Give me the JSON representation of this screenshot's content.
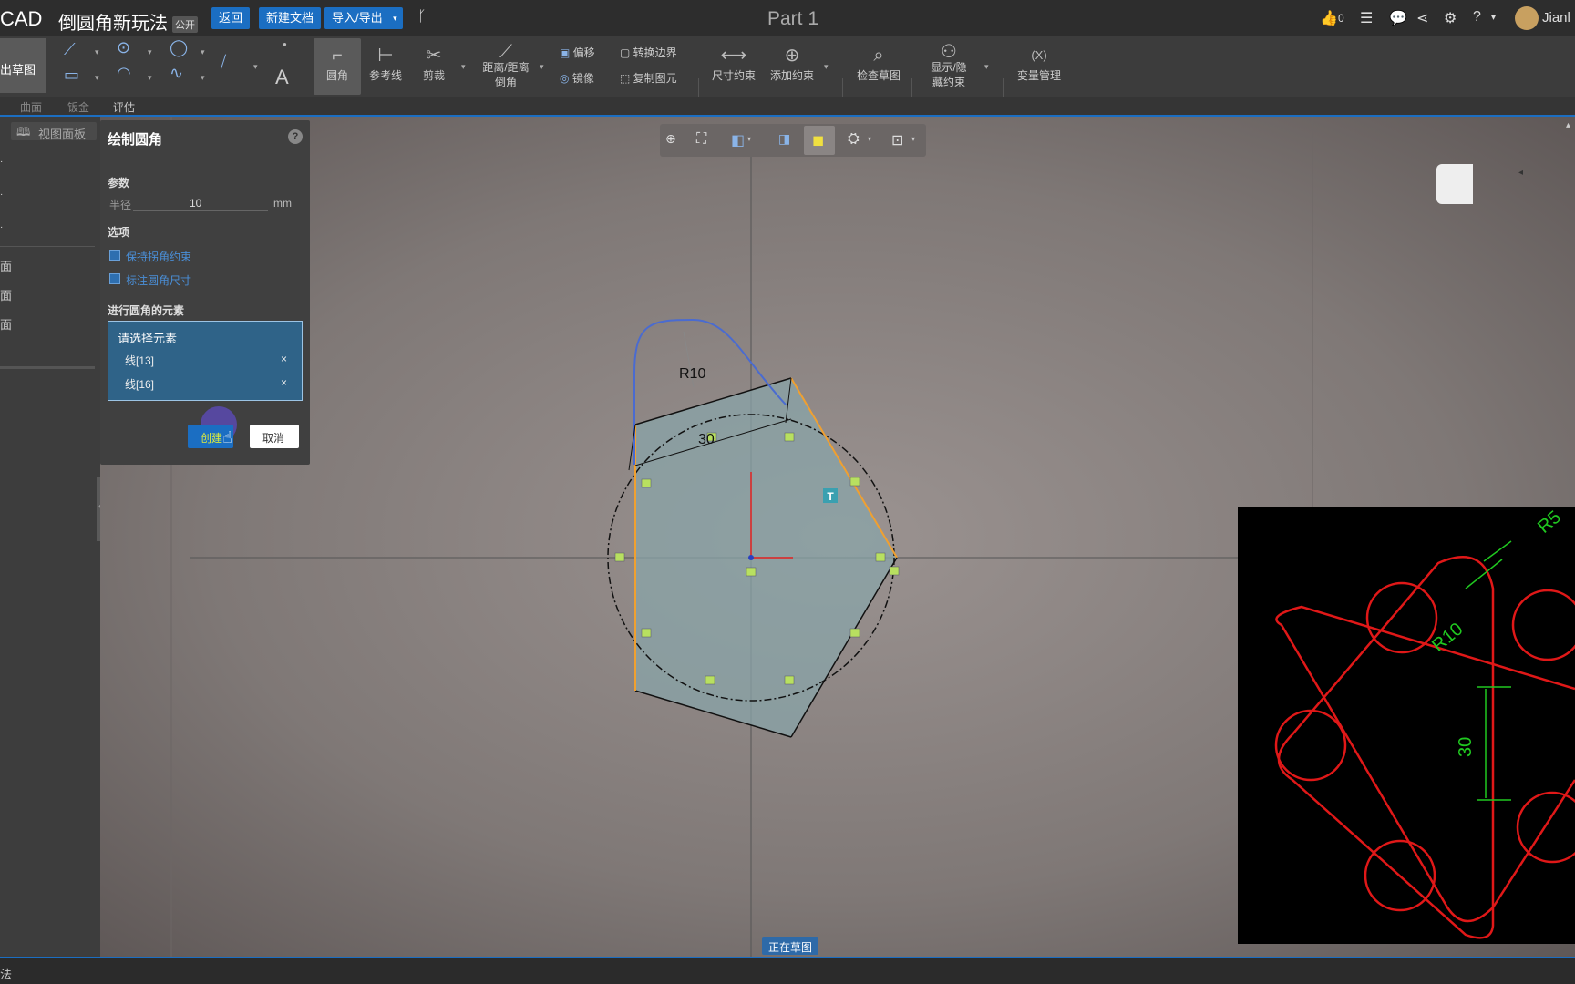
{
  "header": {
    "logo": "CAD",
    "doc_title": "倒圆角新玩法",
    "public_tag": "公开",
    "back_button": "返回",
    "new_doc_button": "新建文档",
    "import_export_button": "导入/导出",
    "part_title": "Part 1",
    "like_count": "0",
    "user_name": "Jianl"
  },
  "ribbon": {
    "exit_sketch": "出草图",
    "fillet": "圆角",
    "reference_line": "参考线",
    "trim": "剪裁",
    "distance_chamfer": "距离/距离倒角",
    "offset": "偏移",
    "mirror": "镜像",
    "convert_boundary": "转换边界",
    "copy_element": "复制图元",
    "dimension_constraint": "尺寸约束",
    "add_constraint": "添加约束",
    "check_sketch": "检查草图",
    "show_hide_constraint": "显示/隐藏约束",
    "variable_icon": "(X)",
    "variable_manager": "变量管理"
  },
  "subtabs": [
    "曲面",
    "钣金",
    "评估"
  ],
  "left_panel": {
    "view_panel": "视图面板",
    "items": [
      "面",
      "面",
      "面"
    ]
  },
  "dialog": {
    "title": "绘制圆角",
    "params_label": "参数",
    "radius_label": "半径",
    "radius_value": "10",
    "unit": "mm",
    "options_label": "选项",
    "option1": "保持拐角约束",
    "option2": "标注圆角尺寸",
    "elements_label": "进行圆角的元素",
    "select_prompt": "请选择元素",
    "elements": [
      "线[13]",
      "线[16]"
    ],
    "remove_symbol": "×",
    "create_button": "创建",
    "cancel_button": "取消"
  },
  "sketch": {
    "radius_dim": "R10",
    "length_dim": "30"
  },
  "inset": {
    "labels": [
      "R5",
      "R10",
      "30"
    ]
  },
  "status": {
    "sketching_badge": "正在草图",
    "bottom_text": "法"
  },
  "colors": {
    "accent": "#1b6ec2",
    "orange_edge": "#f0a030",
    "constraint_green": "#b8e060",
    "inset_red": "#e01818",
    "inset_green": "#20c820"
  }
}
